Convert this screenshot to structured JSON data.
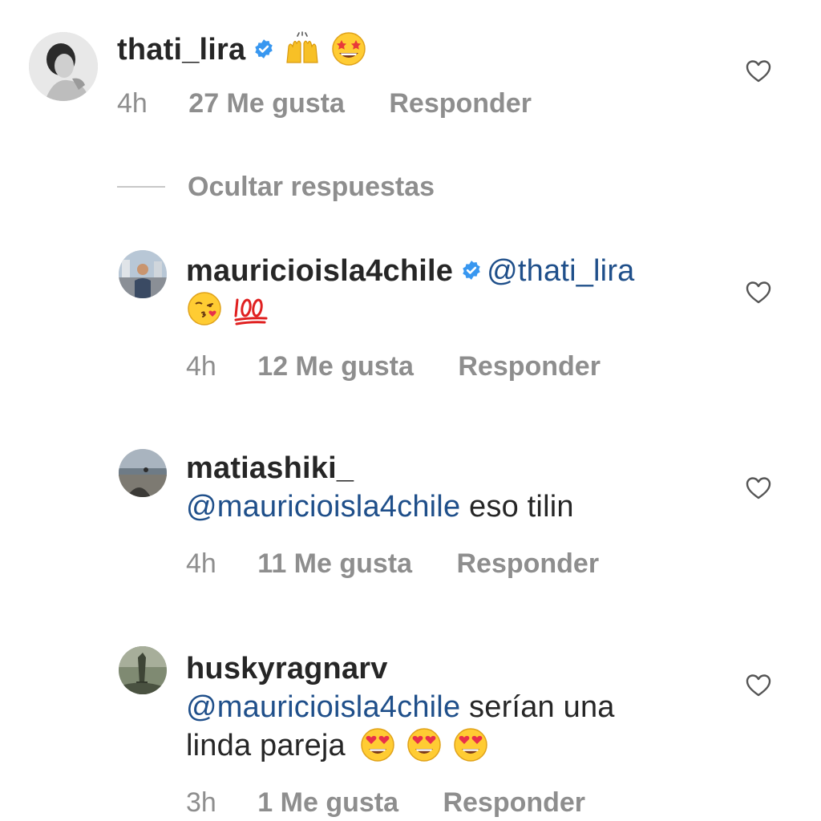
{
  "comments": [
    {
      "username": "thati_lira",
      "verified": true,
      "mention": "",
      "text": "",
      "emojis": [
        "raising-hands",
        "star-struck"
      ],
      "time": "4h",
      "likes": "27 Me gusta",
      "reply": "Responder"
    },
    {
      "username": "mauricioisla4chile",
      "verified": true,
      "mention": "@thati_lira",
      "text": "",
      "emojis": [
        "kissing-heart",
        "hundred-points"
      ],
      "time": "4h",
      "likes": "12 Me gusta",
      "reply": "Responder"
    },
    {
      "username": "matiashiki_",
      "verified": false,
      "mention": "@mauricioisla4chile",
      "text": "eso tilin",
      "emojis": [],
      "time": "4h",
      "likes": "11 Me gusta",
      "reply": "Responder"
    },
    {
      "username": "huskyragnarv",
      "verified": false,
      "mention": "@mauricioisla4chile",
      "text_line1": "serían una",
      "text_line2": "linda pareja",
      "emojis": [
        "heart-eyes",
        "heart-eyes",
        "heart-eyes"
      ],
      "time": "3h",
      "likes": "1 Me gusta",
      "reply": "Responder"
    }
  ],
  "hide_replies": "Ocultar respuestas",
  "colors": {
    "mention": "#1f4f8a",
    "meta": "#8e8e8e",
    "verified": "#3897f0"
  }
}
